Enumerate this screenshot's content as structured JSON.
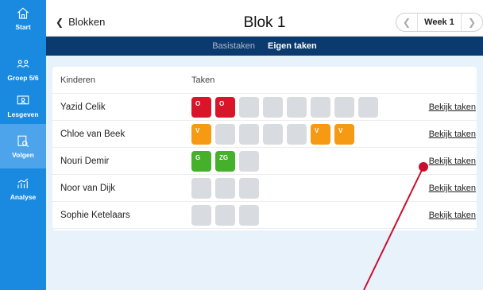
{
  "sidebar": {
    "items": [
      {
        "label": "Start",
        "icon": "home-icon"
      },
      {
        "label": "Groep 5/6",
        "icon": "group-icon"
      },
      {
        "label": "Lesgeven",
        "icon": "teach-icon"
      },
      {
        "label": "Volgen",
        "icon": "follow-icon",
        "active": true
      },
      {
        "label": "Analyse",
        "icon": "analyse-icon"
      }
    ]
  },
  "header": {
    "back_label": "Blokken",
    "title": "Blok 1",
    "week_label": "Week 1"
  },
  "tabs": [
    {
      "label": "Basistaken",
      "active": false
    },
    {
      "label": "Eigen taken",
      "active": true
    }
  ],
  "table": {
    "col_children": "Kinderen",
    "col_tasks": "Taken",
    "link_label": "Bekijk taken",
    "rows": [
      {
        "name": "Yazid Celik",
        "tasks": [
          {
            "label": "O",
            "color": "#d9152a"
          },
          {
            "label": "O",
            "color": "#d9152a"
          },
          {
            "label": "",
            "color": ""
          },
          {
            "label": "",
            "color": ""
          },
          {
            "label": "",
            "color": ""
          },
          {
            "label": "",
            "color": ""
          },
          {
            "label": "",
            "color": ""
          },
          {
            "label": "",
            "color": ""
          }
        ]
      },
      {
        "name": "Chloe van Beek",
        "tasks": [
          {
            "label": "V",
            "color": "#f59a12"
          },
          {
            "label": "",
            "color": ""
          },
          {
            "label": "",
            "color": ""
          },
          {
            "label": "",
            "color": ""
          },
          {
            "label": "",
            "color": ""
          },
          {
            "label": "V",
            "color": "#f59a12"
          },
          {
            "label": "V",
            "color": "#f59a12"
          }
        ]
      },
      {
        "name": "Nouri Demir",
        "tasks": [
          {
            "label": "G",
            "color": "#45b02a"
          },
          {
            "label": "ZG",
            "color": "#45b02a"
          },
          {
            "label": "",
            "color": ""
          }
        ]
      },
      {
        "name": "Noor van Dijk",
        "tasks": [
          {
            "label": "",
            "color": ""
          },
          {
            "label": "",
            "color": ""
          },
          {
            "label": "",
            "color": ""
          }
        ]
      },
      {
        "name": "Sophie Ketelaars",
        "tasks": [
          {
            "label": "",
            "color": ""
          },
          {
            "label": "",
            "color": ""
          },
          {
            "label": "",
            "color": ""
          }
        ]
      }
    ]
  },
  "colors": {
    "sidebar": "#1a8ae0",
    "tabbar": "#0b3a6e",
    "annotation": "#c8102e"
  }
}
